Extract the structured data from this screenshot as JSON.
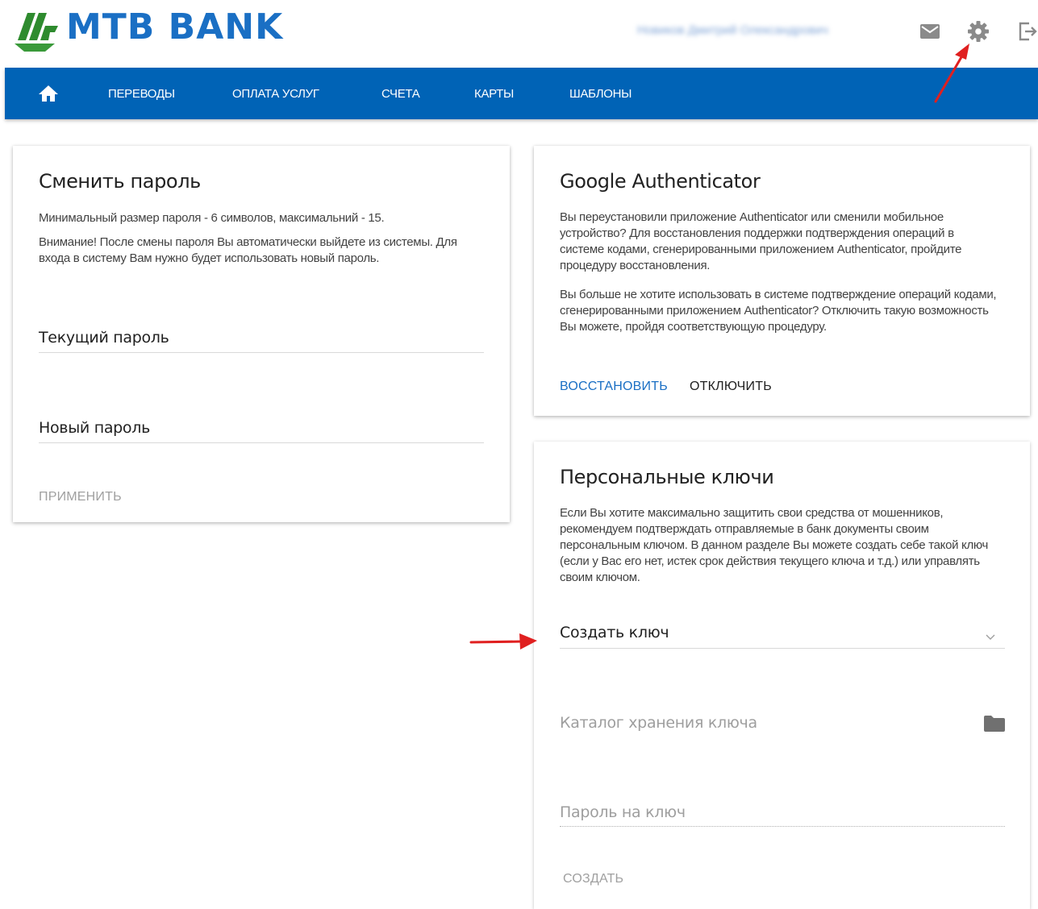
{
  "brand": {
    "name": "MTB BANK",
    "color": "#1a6fc4"
  },
  "header": {
    "user_name": "Новиков Дмитрий Олександрович",
    "icons": [
      "mail-icon",
      "gear-icon",
      "logout-icon"
    ]
  },
  "nav": {
    "home_icon": "home-icon",
    "items": [
      "ПЕРЕВОДЫ",
      "ОПЛАТА УСЛУГ",
      "СЧЕТА",
      "КАРТЫ",
      "ШАБЛОНЫ"
    ],
    "bg_color": "#0063b6"
  },
  "change_password": {
    "title": "Сменить пароль",
    "p1": "Минимальный размер пароля - 6 символов, максимальний - 15.",
    "p2": "Внимание! После смены пароля Вы автоматически выйдете из системы. Для входа в систему Вам нужно будет использовать новый пароль.",
    "current_label": "Текущий пароль",
    "new_label": "Новый пароль",
    "apply_button": "ПРИМЕНИТЬ"
  },
  "google_auth": {
    "title": "Google Authenticator",
    "p1": "Вы переустановили приложение Authenticator или сменили мобильное устройство? Для восстановления поддержки подтверждения операций в системе кодами, сгенерированными приложением Authenticator, пройдите процедуру восстановления.",
    "p2": "Вы больше не хотите использовать в системе подтверждение операций кодами, сгенерированными приложением Authenticator? Отключить такую возможность Вы можете, пройдя соответствующую процедуру.",
    "restore_button": "ВОССТАНОВИТЬ",
    "disable_button": "ОТКЛЮЧИТЬ"
  },
  "personal_keys": {
    "title": "Персональные ключи",
    "p1": "Если Вы хотите максимально защитить свои средства от мошенников, рекомендуем подтверждать отправляемые в банк документы своим персональным ключом. В данном разделе Вы можете создать себе такой ключ (если у Вас его нет, истек срок действия текущего ключа и т.д.) или управлять своим ключом.",
    "select_value": "Создать ключ",
    "catalog_label": "Каталог хранения ключа",
    "key_password_label": "Пароль на ключ",
    "create_button": "СОЗДАТЬ"
  },
  "annotation_color": "#e02020"
}
